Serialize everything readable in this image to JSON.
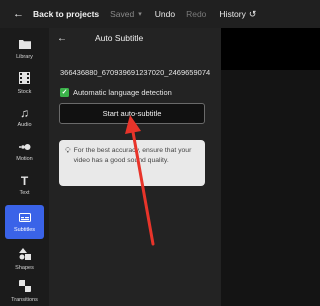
{
  "topbar": {
    "back_label": "Back to projects",
    "saved_label": "Saved",
    "undo_label": "Undo",
    "redo_label": "Redo",
    "history_label": "History"
  },
  "rail": {
    "items": [
      {
        "label": "Library",
        "icon": "folder-icon"
      },
      {
        "label": "Stock",
        "icon": "film-icon"
      },
      {
        "label": "Audio",
        "icon": "music-note-icon"
      },
      {
        "label": "Motion",
        "icon": "motion-icon"
      },
      {
        "label": "Text",
        "icon": "text-icon"
      },
      {
        "label": "Subtitles",
        "icon": "subtitles-icon",
        "active": true
      },
      {
        "label": "Shapes",
        "icon": "shapes-icon"
      },
      {
        "label": "Transitions",
        "icon": "transitions-icon"
      }
    ]
  },
  "panel": {
    "title": "Auto Subtitle",
    "filename": "366436880_670939691237020_2469659074",
    "auto_detect_label": "Automatic language detection",
    "auto_detect_checked": true,
    "start_button_label": "Start auto-subtitle",
    "tip_text": "For the best accuracy, ensure that your video has a good sound quality."
  },
  "colors": {
    "accent": "#3a63e8",
    "check": "#3bb34a",
    "annotation_arrow": "#e8342a"
  }
}
